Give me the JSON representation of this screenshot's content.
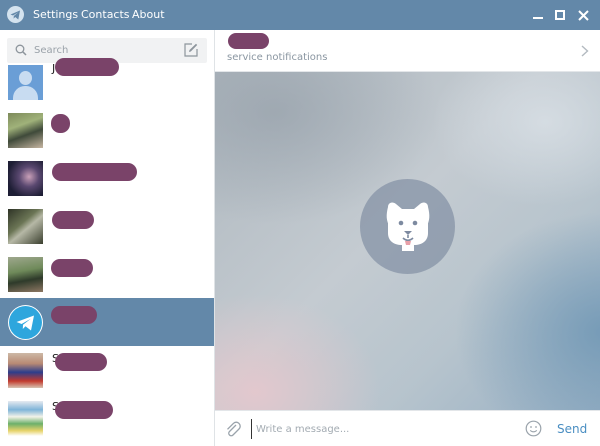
{
  "titlebar": {
    "menu": {
      "settings": "Settings",
      "contacts": "Contacts",
      "about": "About"
    },
    "logo_icon": "telegram-paper-plane-icon",
    "controls": [
      "minimize-icon",
      "maximize-icon",
      "close-icon"
    ]
  },
  "sidebar": {
    "search_placeholder": "Search",
    "chats": [
      {
        "initial": "J",
        "avatar": "default-user-icon",
        "active": false
      },
      {
        "initial": "",
        "avatar": "photo",
        "active": false
      },
      {
        "initial": "",
        "avatar": "photo",
        "active": false
      },
      {
        "initial": "",
        "avatar": "photo",
        "active": false
      },
      {
        "initial": "",
        "avatar": "photo",
        "active": false
      },
      {
        "initial": "",
        "avatar": "telegram-icon",
        "active": true
      },
      {
        "initial": "S",
        "avatar": "photo",
        "active": false
      },
      {
        "initial": "S",
        "avatar": "photo",
        "active": false
      }
    ]
  },
  "chat": {
    "status": "service notifications",
    "composer_placeholder": "Write a message...",
    "send_label": "Send"
  },
  "colors": {
    "titlebar": "#6388a9",
    "active_row": "#6388a9",
    "redaction": "#7a4369",
    "send": "#4a8ec2"
  }
}
